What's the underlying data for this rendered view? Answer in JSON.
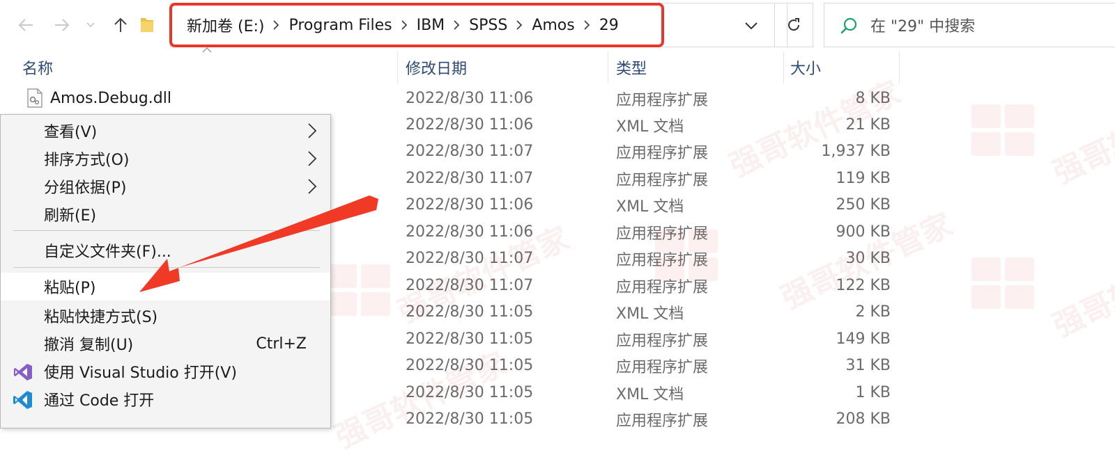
{
  "nav": {
    "breadcrumbs": [
      "新加卷 (E:)",
      "Program Files",
      "IBM",
      "SPSS",
      "Amos",
      "29"
    ],
    "search_placeholder": "在 \"29\" 中搜索",
    "icons": {
      "back": "arrow-left-icon",
      "forward": "arrow-right-icon",
      "recent": "chevron-down-icon",
      "up": "arrow-up-icon",
      "folder": "folder-icon",
      "refresh": "refresh-icon",
      "search": "search-icon"
    }
  },
  "columns": {
    "name": "名称",
    "date": "修改日期",
    "type": "类型",
    "size": "大小"
  },
  "files": [
    {
      "name": "Amos.Debug.dll",
      "date": "2022/8/30 11:06",
      "type": "应用程序扩展",
      "size": "8 KB"
    },
    {
      "name": "",
      "date": "2022/8/30 11:06",
      "type": "XML 文档",
      "size": "21 KB"
    },
    {
      "name": "",
      "date": "2022/8/30 11:07",
      "type": "应用程序扩展",
      "size": "1,937 KB"
    },
    {
      "name": "",
      "date": "2022/8/30 11:07",
      "type": "应用程序扩展",
      "size": "119 KB"
    },
    {
      "name": "",
      "date": "2022/8/30 11:06",
      "type": "XML 文档",
      "size": "250 KB"
    },
    {
      "name": "",
      "date": "2022/8/30 11:06",
      "type": "应用程序扩展",
      "size": "900 KB"
    },
    {
      "name": "",
      "date": "2022/8/30 11:07",
      "type": "应用程序扩展",
      "size": "30 KB"
    },
    {
      "name": "",
      "date": "2022/8/30 11:07",
      "type": "应用程序扩展",
      "size": "122 KB"
    },
    {
      "name": "",
      "date": "2022/8/30 11:05",
      "type": "XML 文档",
      "size": "2 KB"
    },
    {
      "name": "",
      "date": "2022/8/30 11:05",
      "type": "应用程序扩展",
      "size": "149 KB"
    },
    {
      "name": "",
      "date": "2022/8/30 11:05",
      "type": "应用程序扩展",
      "size": "31 KB"
    },
    {
      "name": "",
      "date": "2022/8/30 11:05",
      "type": "XML 文档",
      "size": "1 KB"
    },
    {
      "name": "",
      "date": "2022/8/30 11:05",
      "type": "应用程序扩展",
      "size": "208 KB"
    }
  ],
  "context_menu": {
    "view": "查看(V)",
    "sort": "排序方式(O)",
    "group": "分组依据(P)",
    "refresh": "刷新(E)",
    "customize": "自定义文件夹(F)...",
    "paste": "粘贴(P)",
    "paste_shortcut": "粘贴快捷方式(S)",
    "undo_copy": "撤消 复制(U)",
    "undo_shortcut": "Ctrl+Z",
    "open_vs": "使用 Visual Studio 打开(V)",
    "open_code": "通过 Code 打开",
    "vs_icon": "visual-studio-icon",
    "vscode_icon": "vscode-icon"
  },
  "watermark_text": "强哥软件管家",
  "colors": {
    "highlight": "#e8362b",
    "header_text": "#2d4a76",
    "menu_bg": "#f4f4f4",
    "vs_purple": "#865fc5",
    "vscode_blue": "#1f8ad2"
  }
}
